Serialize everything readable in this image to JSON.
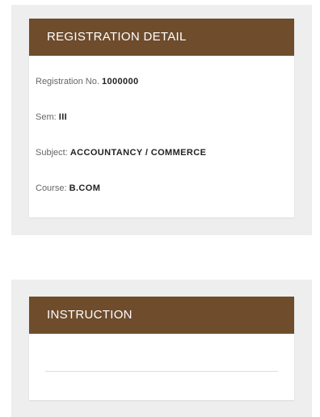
{
  "registration": {
    "header": "REGISTRATION DETAIL",
    "fields": [
      {
        "label": "Registration No.",
        "value": "1000000"
      },
      {
        "label": "Sem:",
        "value": "III"
      },
      {
        "label": "Subject:",
        "value": "ACCOUNTANCY / COMMERCE"
      },
      {
        "label": "Course:",
        "value": "B.COM"
      }
    ]
  },
  "instruction": {
    "header": "INSTRUCTION"
  }
}
